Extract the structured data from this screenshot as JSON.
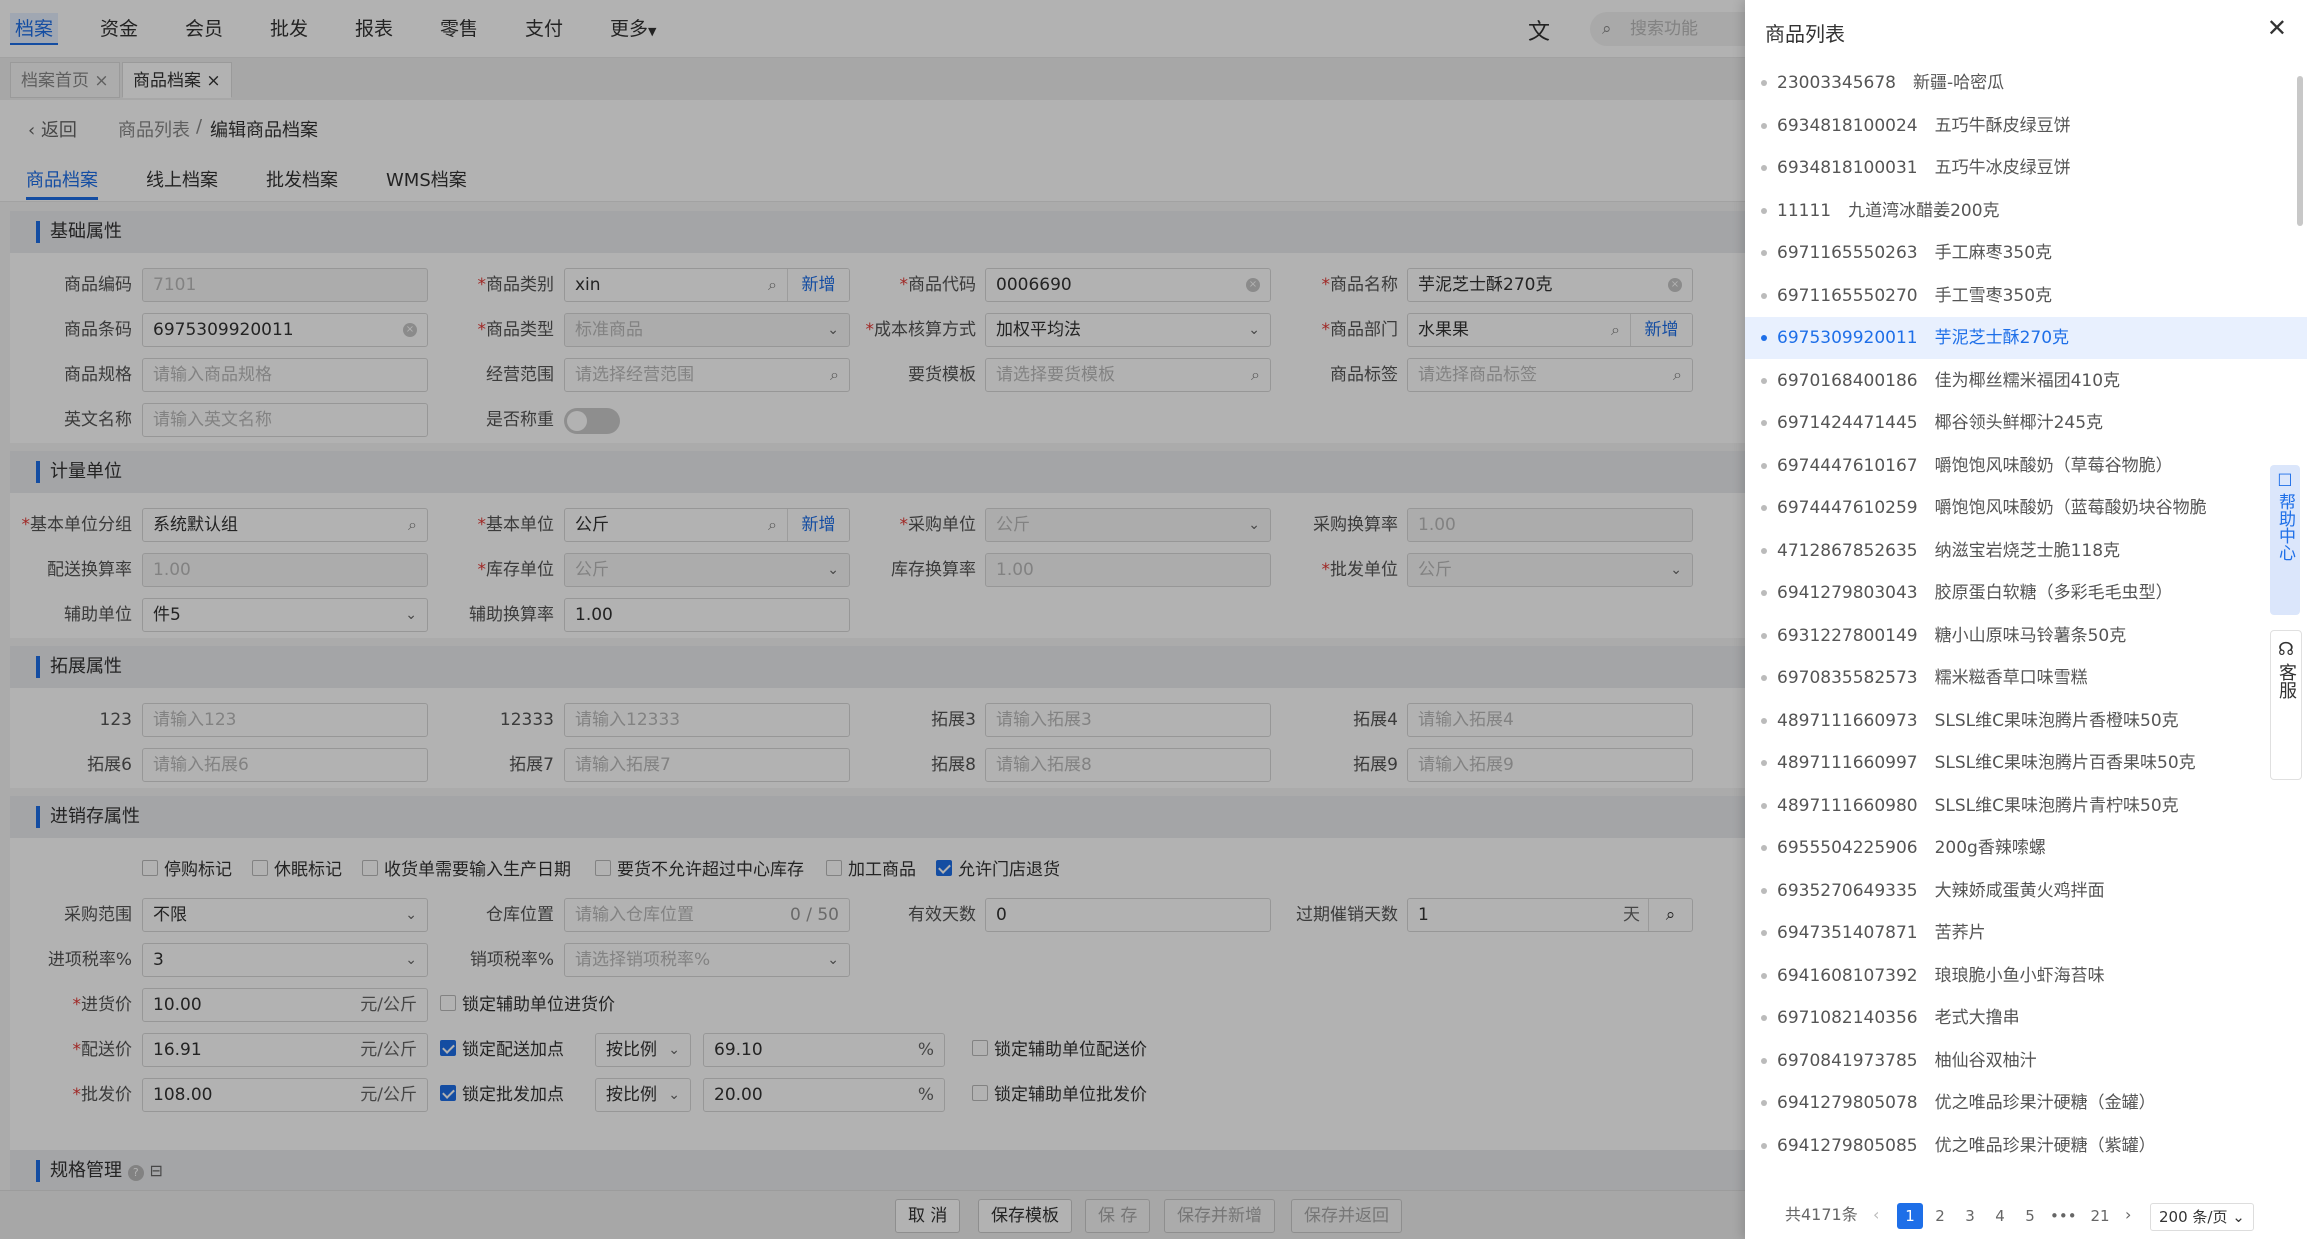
{
  "topnav": {
    "items": [
      "档案",
      "资金",
      "会员",
      "批发",
      "报表",
      "零售",
      "支付",
      "更多"
    ],
    "search_placeholder": "搜索功能"
  },
  "tabs": [
    "档案首页",
    "商品档案"
  ],
  "breadcrumb": {
    "back": "返回",
    "parent": "商品列表",
    "sep": "/",
    "current": "编辑商品档案"
  },
  "subtabs": [
    "商品档案",
    "线上档案",
    "批发档案",
    "WMS档案"
  ],
  "sections": {
    "basic": "基础属性",
    "unit": "计量单位",
    "ext": "拓展属性",
    "inv": "进销存属性",
    "spec": "规格管理"
  },
  "basic": {
    "code_label": "商品编码",
    "code_value": "7101",
    "category_label": "商品类别",
    "category_value": "xin",
    "add": "新增",
    "product_code_label": "商品代码",
    "product_code_value": "0006690",
    "name_label": "商品名称",
    "name_value": "芋泥芝士酥270克",
    "barcode_label": "商品条码",
    "barcode_value": "6975309920011",
    "type_label": "商品类型",
    "type_value": "标准商品",
    "cost_label": "成本核算方式",
    "cost_value": "加权平均法",
    "dept_label": "商品部门",
    "dept_value": "水果果",
    "spec_label": "商品规格",
    "spec_ph": "请输入商品规格",
    "scope_label": "经营范围",
    "scope_ph": "请选择经营范围",
    "tpl_label": "要货模板",
    "tpl_ph": "请选择要货模板",
    "tag_label": "商品标签",
    "tag_ph": "请选择商品标签",
    "en_label": "英文名称",
    "en_ph": "请输入英文名称",
    "weigh_label": "是否称重"
  },
  "unit": {
    "group_label": "基本单位分组",
    "group_value": "系统默认组",
    "base_label": "基本单位",
    "base_value": "公斤",
    "purchase_label": "采购单位",
    "purchase_value": "公斤",
    "prate_label": "采购换算率",
    "prate_value": "1.00",
    "drate_label": "配送换算率",
    "drate_value": "1.00",
    "stock_label": "库存单位",
    "stock_value": "公斤",
    "srate_label": "库存换算率",
    "srate_value": "1.00",
    "whole_label": "批发单位",
    "whole_value": "公斤",
    "aux_label": "辅助单位",
    "aux_value": "件5",
    "arate_label": "辅助换算率",
    "arate_value": "1.00"
  },
  "ext": {
    "f1_label": "123",
    "f1_ph": "请输入123",
    "f2_label": "12333",
    "f2_ph": "请输入12333",
    "f3_label": "拓展3",
    "f3_ph": "请输入拓展3",
    "f4_label": "拓展4",
    "f4_ph": "请输入拓展4",
    "f6_label": "拓展6",
    "f6_ph": "请输入拓展6",
    "f7_label": "拓展7",
    "f7_ph": "请输入拓展7",
    "f8_label": "拓展8",
    "f8_ph": "请输入拓展8",
    "f9_label": "拓展9",
    "f9_ph": "请输入拓展9"
  },
  "inv": {
    "checks": [
      "停购标记",
      "休眠标记",
      "收货单需要输入生产日期",
      "要货不允许超过中心库存",
      "加工商品",
      "允许门店退货"
    ],
    "range_label": "采购范围",
    "range_value": "不限",
    "loc_label": "仓库位置",
    "loc_ph": "请输入仓库位置",
    "loc_count": "0 / 50",
    "days_label": "有效天数",
    "days_value": "0",
    "expire_label": "过期催销天数",
    "expire_value": "1",
    "expire_unit": "天",
    "intax_label": "进项税率%",
    "intax_value": "3",
    "outtax_label": "销项税率%",
    "outtax_ph": "请选择销项税率%",
    "inprice_label": "进货价",
    "inprice_value": "10.00",
    "price_unit": "元/公斤",
    "lock_aux_in": "锁定辅助单位进货价",
    "dprice_label": "配送价",
    "dprice_value": "16.91",
    "lock_d": "锁定配送加点",
    "ratio": "按比例",
    "d_pct": "69.10",
    "pct": "%",
    "lock_aux_d": "锁定辅助单位配送价",
    "wprice_label": "批发价",
    "wprice_value": "108.00",
    "lock_w": "锁定批发加点",
    "w_pct": "20.00",
    "lock_aux_w": "锁定辅助单位批发价"
  },
  "footer": [
    "取 消",
    "保存模板",
    "保 存",
    "保存并新增",
    "保存并返回"
  ],
  "drawer": {
    "title": "商品列表",
    "items": [
      "23003345678　新疆-哈密瓜",
      "6934818100024　五巧牛酥皮绿豆饼",
      "6934818100031　五巧牛冰皮绿豆饼",
      "11111　九道湾冰醋姜200克",
      "6971165550263　手工麻枣350克",
      "6971165550270　手工雪枣350克",
      "6975309920011　芋泥芝士酥270克",
      "6970168400186　佳为椰丝糯米福团410克",
      "6971424471445　椰谷领头鲜椰汁245克",
      "6974447610167　嚼饱饱风味酸奶（草莓谷物脆）",
      "6974447610259　嚼饱饱风味酸奶（蓝莓酸奶块谷物脆",
      "4712867852635　纳滋宝岩烧芝士脆118克",
      "6941279803043　胶原蛋白软糖（多彩毛毛虫型）",
      "6931227800149　糖小山原味马铃薯条50克",
      "6970835582573　糯米糍香草口味雪糕",
      "4897111660973　SLSL维C果味泡腾片香橙味50克",
      "4897111660997　SLSL维C果味泡腾片百香果味50克",
      "4897111660980　SLSL维C果味泡腾片青柠味50克",
      "6955504225906　200g香辣嗦螺",
      "6935270649335　大辣娇咸蛋黄火鸡拌面",
      "6947351407871　苦荞片",
      "6941608107392　琅琅脆小鱼小虾海苔味",
      "6971082140356　老式大撸串",
      "6970841973785　柚仙谷双柚汁",
      "6941279805078　优之唯品珍果汁硬糖（金罐）",
      "6941279805085　优之唯品珍果汁硬糖（紫罐）"
    ],
    "selected_index": 6,
    "total": "共4171条",
    "pages": [
      "1",
      "2",
      "3",
      "4",
      "5",
      "•••",
      "21"
    ],
    "page_size": "200 条/页"
  },
  "float": {
    "help": "帮助中心",
    "cs": "客服"
  },
  "colors": {
    "accent": "#1e6fe8",
    "required": "#e53935"
  }
}
